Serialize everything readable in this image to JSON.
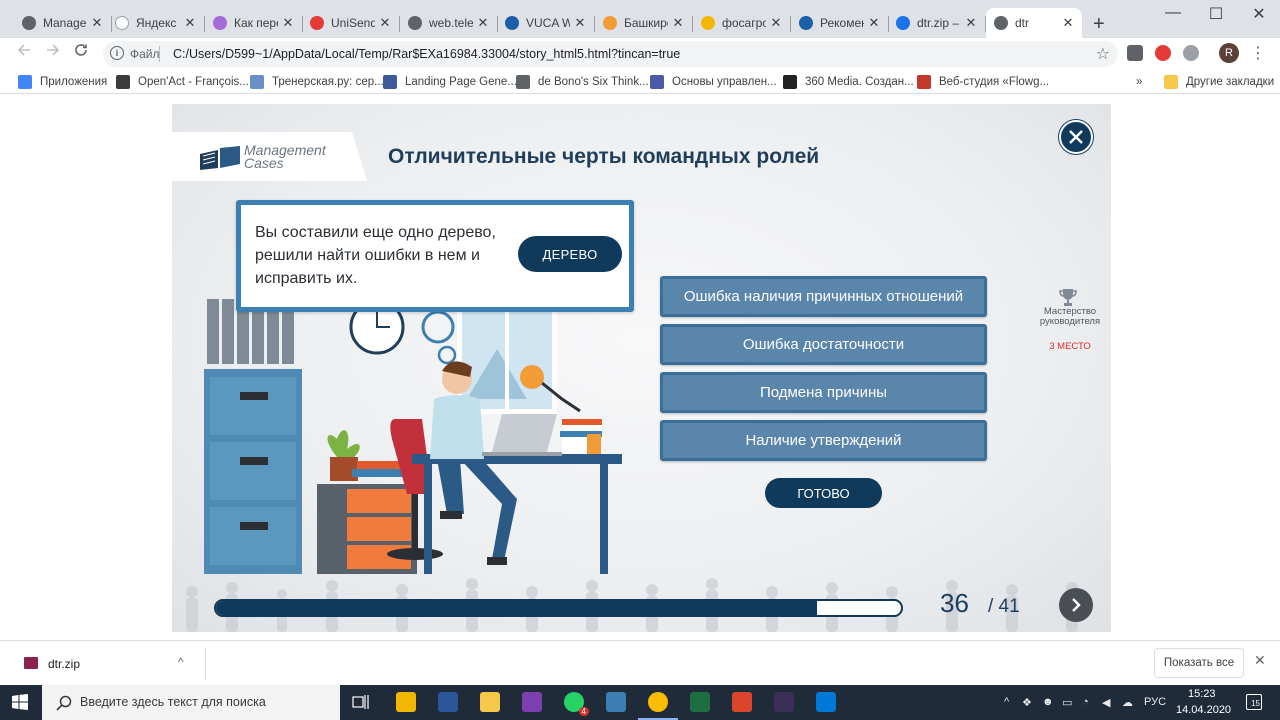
{
  "browser": {
    "tabs": [
      {
        "label": "Manager",
        "icon": "globe-icon",
        "color": "#5f6368"
      },
      {
        "label": "Яндекс",
        "icon": "yandex-icon",
        "color": "#ffffff"
      },
      {
        "label": "Как пере",
        "icon": "chat-icon",
        "color": "#a36bd8"
      },
      {
        "label": "UniSender",
        "icon": "unisender-icon",
        "color": "#e53935"
      },
      {
        "label": "web.teleg",
        "icon": "globe-icon",
        "color": "#5f6368"
      },
      {
        "label": "VUCA W",
        "icon": "vuca-icon",
        "color": "#1a5fa8"
      },
      {
        "label": "Башкиро",
        "icon": "sun-icon",
        "color": "#f29c38"
      },
      {
        "label": "фосагро",
        "icon": "photo-icon",
        "color": "#f2b705"
      },
      {
        "label": "Рекомен",
        "icon": "vuca-icon",
        "color": "#1a5fa8"
      },
      {
        "label": "dtr.zip –",
        "icon": "drive-icon",
        "color": "#1a73e8"
      },
      {
        "label": "dtr",
        "icon": "globe-icon",
        "color": "#5f6368"
      }
    ],
    "active_tab": 10,
    "close_glyph": "✕",
    "new_tab_glyph": "+",
    "window_controls": {
      "minimize": "—",
      "maximize": "☐",
      "close": "✕"
    },
    "omnibox": {
      "info_glyph": "i",
      "scheme_label": "Файл",
      "url": "C:/Users/D599~1/AppData/Local/Temp/Rar$EXa16984.33004/story_html5.html?tincan=true"
    },
    "avatar_letter": "R",
    "bookmarks": [
      {
        "label": "Приложения",
        "color": "#4285f4"
      },
      {
        "label": "Open'Act - François...",
        "color": "#3b3b3b"
      },
      {
        "label": "Тренерская.ру: сер...",
        "color": "#6a8fc7"
      },
      {
        "label": "Landing Page Gene...",
        "color": "#3d5a99"
      },
      {
        "label": "de Bono's Six Think...",
        "color": "#5f6368"
      },
      {
        "label": "Основы управлен...",
        "color": "#4a5aa8"
      },
      {
        "label": "360 Media. Создан...",
        "color": "#222222"
      },
      {
        "label": "Веб-студия «Flowg...",
        "color": "#c0392b"
      }
    ],
    "bookmarks_overflow": "»",
    "other_bookmarks": "Другие закладки"
  },
  "slide": {
    "logo_line1": "Management",
    "logo_line2": "Cases",
    "title": "Отличительные черты командных ролей",
    "callout_text": "Вы составили еще одно дерево, решили найти ошибки в нем и исправить их.",
    "callout_button": "ДЕРЕВО",
    "options": [
      "Ошибка наличия причинных отношений",
      "Ошибка достаточности",
      "Подмена причины",
      "Наличие утверждений"
    ],
    "done_button": "ГОТОВО",
    "mastery_label": "Мастерство руководителя",
    "place_label": "3 МЕСТО",
    "progress": {
      "current": 36,
      "total": 41,
      "fraction": 0.878
    },
    "current_label": "36",
    "total_label": "/ 41",
    "colors": {
      "navy": "#0f3a5c",
      "option": "#5a86ac",
      "accent_red": "#d9302c"
    }
  },
  "downloads": {
    "file_name": "dtr.zip",
    "chevron": "^",
    "show_all": "Показать все",
    "close": "✕"
  },
  "taskbar": {
    "search_placeholder": "Введите здесь текст для поиска",
    "whatsapp_badge": "4",
    "language": "РУС",
    "time": "15:23",
    "date": "14.04.2020",
    "notifications": "15"
  }
}
